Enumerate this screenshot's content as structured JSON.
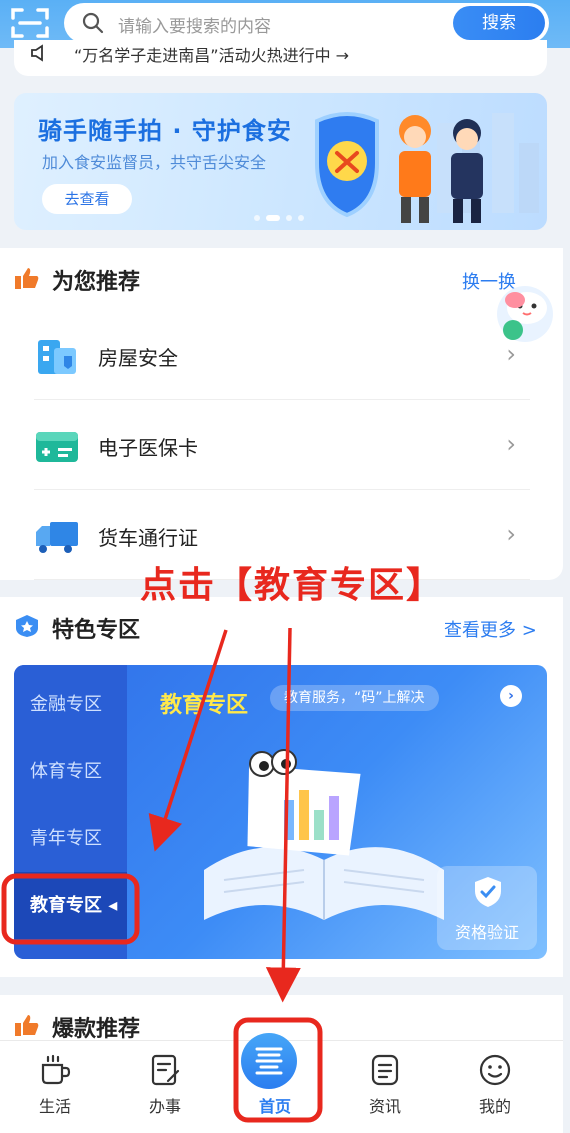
{
  "search": {
    "placeholder": "请输入要搜索的内容",
    "button": "搜索"
  },
  "notice": {
    "text": "“万名学子走进南昌”活动火热进行中 →"
  },
  "banner": {
    "title": "骑手随手拍 · 守护食安",
    "subtitle": "加入食安监督员，共守舌尖安全",
    "button": "去查看"
  },
  "recommend": {
    "title": "为您推荐",
    "refresh": "换一换",
    "items": [
      {
        "label": "房屋安全",
        "icon": "house-safety-icon"
      },
      {
        "label": "电子医保卡",
        "icon": "medical-card-icon"
      },
      {
        "label": "货车通行证",
        "icon": "truck-icon"
      }
    ]
  },
  "annotation": {
    "text": "点击【教育专区】"
  },
  "featured": {
    "title": "特色专区",
    "more": "查看更多 >",
    "sidebar": [
      {
        "label": "金融专区",
        "active": false
      },
      {
        "label": "体育专区",
        "active": false
      },
      {
        "label": "青年专区",
        "active": false
      },
      {
        "label": "教育专区",
        "active": true
      }
    ],
    "active_marker": "◂",
    "zone_title": "教育专区",
    "zone_tag": "教育服务，“码”上解决",
    "verify": "资格验证"
  },
  "hot": {
    "title": "爆款推荐"
  },
  "tabbar": [
    {
      "label": "生活",
      "icon": "coffee-cup-icon"
    },
    {
      "label": "办事",
      "icon": "form-edit-icon"
    },
    {
      "label": "首页",
      "icon": "home-logo-icon",
      "active": true
    },
    {
      "label": "资讯",
      "icon": "news-doc-icon"
    },
    {
      "label": "我的",
      "icon": "smile-face-icon"
    }
  ],
  "colors": {
    "accent": "#2b7df0",
    "annotation": "#e8281e",
    "zone_title": "#ffe94a"
  }
}
